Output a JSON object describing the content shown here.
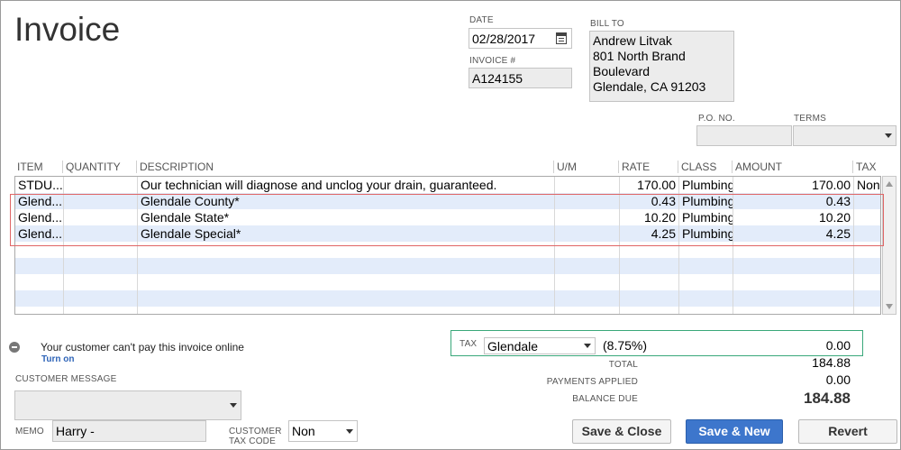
{
  "form": {
    "title": "Invoice"
  },
  "header": {
    "date_label": "DATE",
    "date_value": "02/28/2017",
    "invoice_label": "INVOICE #",
    "invoice_value": "A124155",
    "bill_to_label": "BILL TO",
    "bill_to_lines": [
      "Andrew Litvak",
      "801 North Brand Boulevard",
      "Glendale, CA 91203"
    ],
    "po_label": "P.O. NO.",
    "po_value": "",
    "terms_label": "TERMS",
    "terms_value": ""
  },
  "grid": {
    "columns": [
      "ITEM",
      "QUANTITY",
      "DESCRIPTION",
      "U/M",
      "RATE",
      "CLASS",
      "AMOUNT",
      "TAX"
    ],
    "rows": [
      {
        "item": "STDU...",
        "quantity": "",
        "description": "Our technician will diagnose and unclog your drain, guaranteed.",
        "um": "",
        "rate": "170.00",
        "class": "Plumbing",
        "amount": "170.00",
        "tax": "Non"
      },
      {
        "item": "Glend...",
        "quantity": "",
        "description": "Glendale County*",
        "um": "",
        "rate": "0.43",
        "class": "Plumbing",
        "amount": "0.43",
        "tax": ""
      },
      {
        "item": "Glend...",
        "quantity": "",
        "description": "Glendale State*",
        "um": "",
        "rate": "10.20",
        "class": "Plumbing",
        "amount": "10.20",
        "tax": ""
      },
      {
        "item": "Glend...",
        "quantity": "",
        "description": "Glendale Special*",
        "um": "",
        "rate": "4.25",
        "class": "Plumbing",
        "amount": "4.25",
        "tax": ""
      }
    ]
  },
  "online": {
    "message": "Your customer can't pay this invoice online",
    "link": "Turn on"
  },
  "customer_message": {
    "label": "CUSTOMER MESSAGE",
    "value": ""
  },
  "memo": {
    "label": "MEMO",
    "value": "Harry -"
  },
  "tax_code": {
    "label_line1": "CUSTOMER",
    "label_line2": "TAX CODE",
    "value": "Non"
  },
  "tax": {
    "label": "TAX",
    "item": "Glendale",
    "rate": "(8.75%)",
    "amount": "0.00"
  },
  "totals": {
    "total_label": "TOTAL",
    "total": "184.88",
    "payments_label": "PAYMENTS APPLIED",
    "payments": "0.00",
    "balance_label": "BALANCE DUE",
    "balance": "184.88"
  },
  "buttons": {
    "save_close": "Save & Close",
    "save_new": "Save & New",
    "revert": "Revert"
  },
  "colors": {
    "primary_button": "#3d76cc",
    "highlight_red": "#e06666",
    "highlight_green": "#3aa87a",
    "alt_row": "#e3ecfa"
  }
}
